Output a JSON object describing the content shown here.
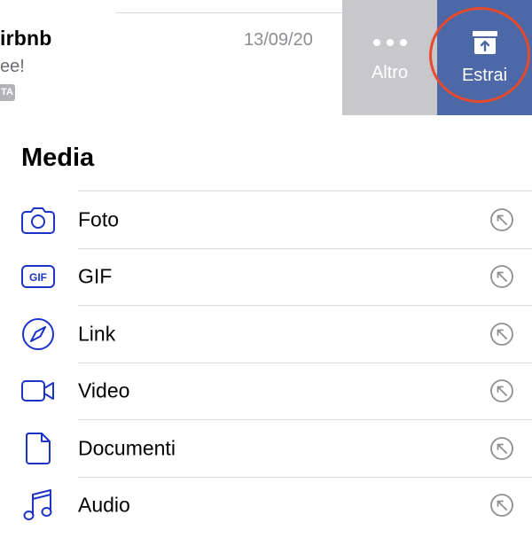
{
  "message": {
    "sender": "irbnb",
    "preview": "ee!",
    "tag": "TA",
    "date": "13/09/20"
  },
  "actions": {
    "altro_label": "Altro",
    "estrai_label": "Estrai"
  },
  "colors": {
    "altro_bg": "#c7c7cc",
    "estrai_bg": "#4c68a6",
    "annotation": "#e64a2e",
    "icon_blue": "#1c33c8"
  },
  "media": {
    "title": "Media",
    "items": [
      {
        "label": "Foto",
        "icon": "camera-icon"
      },
      {
        "label": "GIF",
        "icon": "gif-icon"
      },
      {
        "label": "Link",
        "icon": "compass-icon"
      },
      {
        "label": "Video",
        "icon": "video-camera-icon"
      },
      {
        "label": "Documenti",
        "icon": "document-icon"
      },
      {
        "label": "Audio",
        "icon": "music-note-icon"
      }
    ]
  }
}
